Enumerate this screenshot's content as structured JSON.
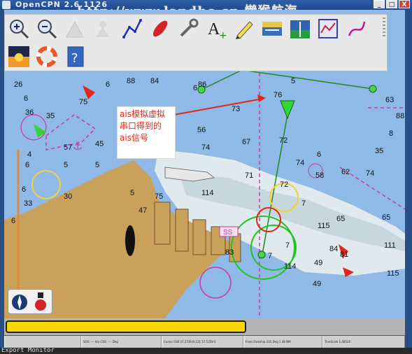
{
  "window": {
    "title": "OpenCPN 2.6.1126",
    "buttons": [
      "_",
      "□",
      "X"
    ]
  },
  "watermark": "http://www.landho.cn  懒猴航海",
  "toolbar": {
    "tools": [
      "zoom-in",
      "zoom-out",
      "scale-in",
      "scale-out",
      "route",
      "ais",
      "settings",
      "text",
      "tide",
      "current",
      "zoom-to-route",
      "route-manager",
      "track",
      "sunrise",
      "lifebuoy",
      "help"
    ]
  },
  "callout": {
    "text": "ais模拟虚拟串口得到的ais信号"
  },
  "chart": {
    "soundings": [
      "26",
      "6",
      "36",
      "35",
      "4",
      "57",
      "45",
      "5",
      "6",
      "5",
      "6",
      "33",
      "30",
      "6",
      "5",
      "47",
      "75",
      "6",
      "75",
      "86",
      "84",
      "88",
      "74",
      "67",
      "56",
      "73",
      "71",
      "74",
      "72",
      "74",
      "114",
      "72",
      "83",
      "49",
      "65",
      "84",
      "81",
      "76",
      "6",
      "115",
      "6",
      "111",
      "114",
      "7",
      "35",
      "63",
      "7",
      "49",
      "8",
      "5",
      "88",
      "65",
      "115",
      "62",
      "58",
      "7"
    ],
    "labels": {
      "ss": "SS"
    },
    "colors": {
      "land": "#c9a15a",
      "deep": "#8fb9e6",
      "shallow": "#dfe9ee",
      "dredged": "#c6d8de"
    }
  },
  "status": {
    "sog": "SOG ---- kts  COG ---- Deg",
    "cursor": "Cursor 038 37.2738 N 121 57.5358 E",
    "from": "From Ownship 331 Deg  1.48 NM",
    "scale": "TrueScale 1:48520",
    "blank": ""
  },
  "bottom_text": "Export Monitor"
}
